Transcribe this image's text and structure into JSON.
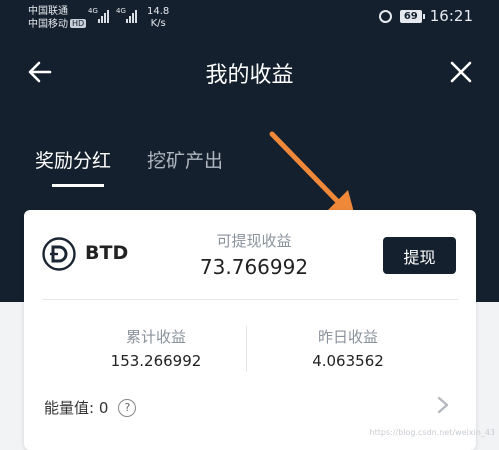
{
  "status_bar": {
    "carrier_1": "中国联通",
    "carrier_2": "中国移动",
    "hd_badge": "HD",
    "signal_1_label": "4G",
    "signal_2_label": "4G",
    "net_speed": "14.8",
    "net_speed_unit": "K/s",
    "battery": "69",
    "time": "16:21"
  },
  "header": {
    "title": "我的收益",
    "back_icon": "arrow-left-icon",
    "close_icon": "close-icon"
  },
  "tabs": [
    {
      "label": "奖励分红",
      "active": true
    },
    {
      "label": "挖矿产出",
      "active": false
    }
  ],
  "card": {
    "coin_name": "BTD",
    "withdrawable_label": "可提现收益",
    "withdrawable_value": "73.766992",
    "withdraw_button": "提现",
    "total_label": "累计收益",
    "total_value": "153.266992",
    "yesterday_label": "昨日收益",
    "yesterday_value": "4.063562",
    "energy_label": "能量值: 0",
    "help_icon_text": "?"
  },
  "watermark": "https://blog.csdn.net/weixin_43",
  "colors": {
    "header_bg": "#14202d",
    "annotation_arrow": "#f0883a",
    "button_bg": "#14202d"
  }
}
